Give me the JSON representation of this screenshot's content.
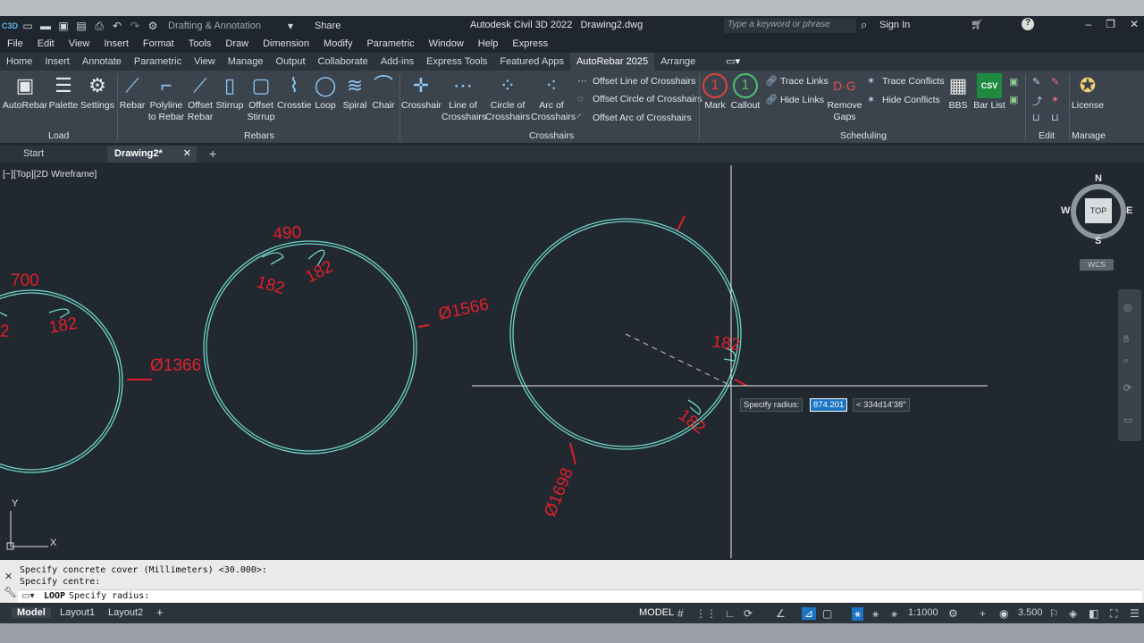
{
  "app": {
    "title": "Autodesk Civil 3D 2022",
    "file": "Drawing2.dwg",
    "workspace": "Drafting & Annotation",
    "share": "Share",
    "search_placeholder": "Type a keyword or phrase",
    "signin": "Sign In"
  },
  "menubar": [
    "File",
    "Edit",
    "View",
    "Insert",
    "Format",
    "Tools",
    "Draw",
    "Dimension",
    "Modify",
    "Parametric",
    "Window",
    "Help",
    "Express"
  ],
  "ribbon_tabs": [
    "Home",
    "Insert",
    "Annotate",
    "Parametric",
    "View",
    "Manage",
    "Output",
    "Collaborate",
    "Add-ins",
    "Express Tools",
    "Featured Apps",
    "AutoRebar 2025",
    "Arrange"
  ],
  "active_tab": "AutoRebar 2025",
  "ribbon": {
    "load": {
      "label": "Load",
      "buttons": [
        "AutoRebar",
        "Palette",
        "Settings"
      ]
    },
    "rebars": {
      "label": "Rebars",
      "buttons": [
        "Rebar",
        "Polyline\nto Rebar",
        "Offset\nRebar",
        "Stirrup",
        "Offset\nStirrup",
        "Crosstie",
        "Loop",
        "Spiral",
        "Chair"
      ]
    },
    "crosshairs": {
      "label": "Crosshairs",
      "buttons": [
        "Crosshair",
        "Line of\nCrosshairs",
        "Circle of\nCrosshairs",
        "Arc of\nCrosshairs"
      ],
      "small": [
        "Offset Line of Crosshairs",
        "Offset Circle of Crosshairs",
        "Offset Arc of Crosshairs"
      ]
    },
    "scheduling": {
      "label": "Scheduling",
      "buttons": [
        "Mark",
        "Callout",
        "Remove\nGaps",
        "BBS",
        "Bar List"
      ],
      "small": [
        "Trace Links",
        "Hide Links",
        "Trace Conflicts",
        "Hide Conflicts"
      ]
    },
    "edit": {
      "label": "Edit"
    },
    "manage": {
      "label": "Manage",
      "buttons": [
        "License"
      ]
    }
  },
  "doc_tabs": [
    "Start",
    "Drawing2*"
  ],
  "viewport_label": "[−][Top][2D Wireframe]",
  "viewcube": {
    "n": "N",
    "s": "S",
    "e": "E",
    "w": "W",
    "top": "TOP",
    "wcs": "WCS"
  },
  "drawing_labels": {
    "c1_top": "700",
    "c1_a": "182",
    "c1_b": "2",
    "c1_dia": "Ø1366",
    "c2_top": "490",
    "c2_a": "182",
    "c2_b": "182",
    "c2_dia": "Ø1566",
    "c3_a": "182",
    "c3_b": "182",
    "c3_dia": "Ø1698"
  },
  "tooltip": {
    "prompt": "Specify radius:",
    "value": "874.201",
    "angle": "< 334d14'38\""
  },
  "command_history": [
    "Specify concrete cover (Millimeters) <30.000>:",
    "Specify centre:"
  ],
  "command_current": {
    "cmd": "LOOP",
    "text": "Specify radius:"
  },
  "layouts": [
    "Model",
    "Layout1",
    "Layout2"
  ],
  "status": {
    "model": "MODEL",
    "scale": "1:1000",
    "anno": "3.500"
  },
  "colors": {
    "rebar": "#6fd3c8",
    "label": "#e0202a",
    "accent": "#1b74c4"
  }
}
